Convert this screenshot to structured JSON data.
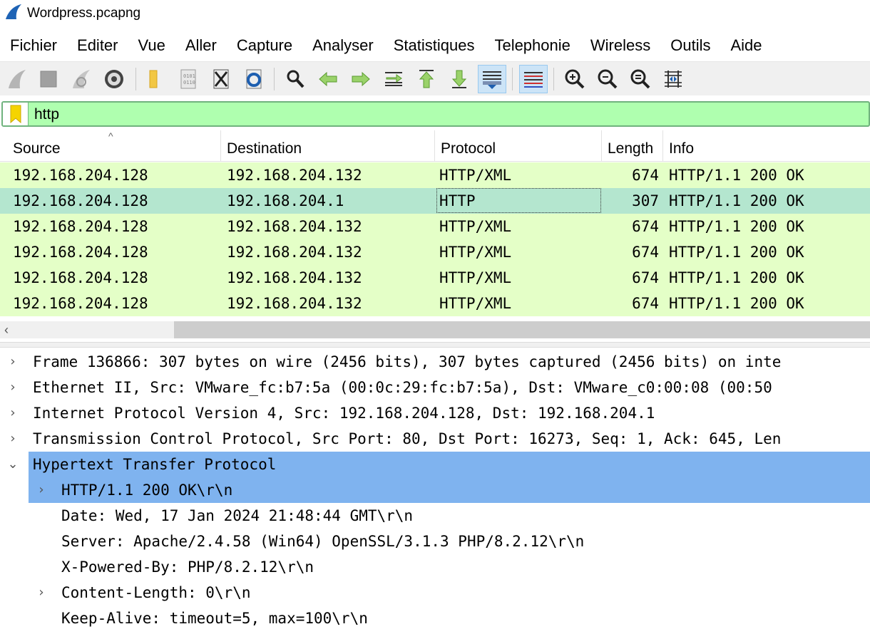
{
  "window": {
    "title": "Wordpress.pcapng"
  },
  "menu": [
    "Fichier",
    "Editer",
    "Vue",
    "Aller",
    "Capture",
    "Analyser",
    "Statistiques",
    "Telephonie",
    "Wireless",
    "Outils",
    "Aide"
  ],
  "toolbar": {
    "icons": [
      "start-capture-icon",
      "stop-capture-icon",
      "restart-capture-icon",
      "capture-options-icon",
      "open-file-icon",
      "save-file-icon",
      "close-file-icon",
      "reload-file-icon",
      "find-packet-icon",
      "go-back-icon",
      "go-forward-icon",
      "go-to-packet-icon",
      "first-packet-icon",
      "last-packet-icon",
      "auto-scroll-icon",
      "colorize-icon",
      "zoom-in-icon",
      "zoom-out-icon",
      "normal-size-icon",
      "resize-columns-icon"
    ]
  },
  "filter": {
    "value": "http"
  },
  "packet_list": {
    "columns": [
      "Source",
      "Destination",
      "Protocol",
      "Length",
      "Info"
    ],
    "rows": [
      {
        "source": "192.168.204.128",
        "destination": "192.168.204.132",
        "protocol": "HTTP/XML",
        "length": "674",
        "info": "HTTP/1.1 200 OK"
      },
      {
        "source": "192.168.204.128",
        "destination": "192.168.204.1",
        "protocol": "HTTP",
        "length": "307",
        "info": "HTTP/1.1 200 OK"
      },
      {
        "source": "192.168.204.128",
        "destination": "192.168.204.132",
        "protocol": "HTTP/XML",
        "length": "674",
        "info": "HTTP/1.1 200 OK"
      },
      {
        "source": "192.168.204.128",
        "destination": "192.168.204.132",
        "protocol": "HTTP/XML",
        "length": "674",
        "info": "HTTP/1.1 200 OK"
      },
      {
        "source": "192.168.204.128",
        "destination": "192.168.204.132",
        "protocol": "HTTP/XML",
        "length": "674",
        "info": "HTTP/1.1 200 OK"
      },
      {
        "source": "192.168.204.128",
        "destination": "192.168.204.132",
        "protocol": "HTTP/XML",
        "length": "674",
        "info": "HTTP/1.1 200 OK"
      }
    ],
    "selected_row": 1
  },
  "details": [
    {
      "text": "Frame 136866: 307 bytes on wire (2456 bits), 307 bytes captured (2456 bits) on inte",
      "expander": "collapsed"
    },
    {
      "text": "Ethernet II, Src: VMware_fc:b7:5a (00:0c:29:fc:b7:5a), Dst: VMware_c0:00:08 (00:50",
      "expander": "collapsed"
    },
    {
      "text": "Internet Protocol Version 4, Src: 192.168.204.128, Dst: 192.168.204.1",
      "expander": "collapsed"
    },
    {
      "text": "Transmission Control Protocol, Src Port: 80, Dst Port: 16273, Seq: 1, Ack: 645, Len",
      "expander": "collapsed"
    },
    {
      "text": "Hypertext Transfer Protocol",
      "expander": "expanded"
    },
    {
      "text": "HTTP/1.1 200 OK\\r\\n",
      "expander": "collapsed"
    },
    {
      "text": "Date: Wed, 17 Jan 2024 21:48:44 GMT\\r\\n",
      "expander": "none"
    },
    {
      "text": "Server: Apache/2.4.58 (Win64) OpenSSL/3.1.3 PHP/8.2.12\\r\\n",
      "expander": "none"
    },
    {
      "text": "X-Powered-By: PHP/8.2.12\\r\\n",
      "expander": "none"
    },
    {
      "text": "Content-Length: 0\\r\\n",
      "expander": "collapsed"
    },
    {
      "text": "Keep-Alive: timeout=5, max=100\\r\\n",
      "expander": "none"
    }
  ],
  "colors": {
    "row_bg": "#e4ffc7",
    "row_selected_bg": "#b4e6cf",
    "filter_bg": "#afffaf",
    "tree_highlight": "#7fb3ef"
  }
}
